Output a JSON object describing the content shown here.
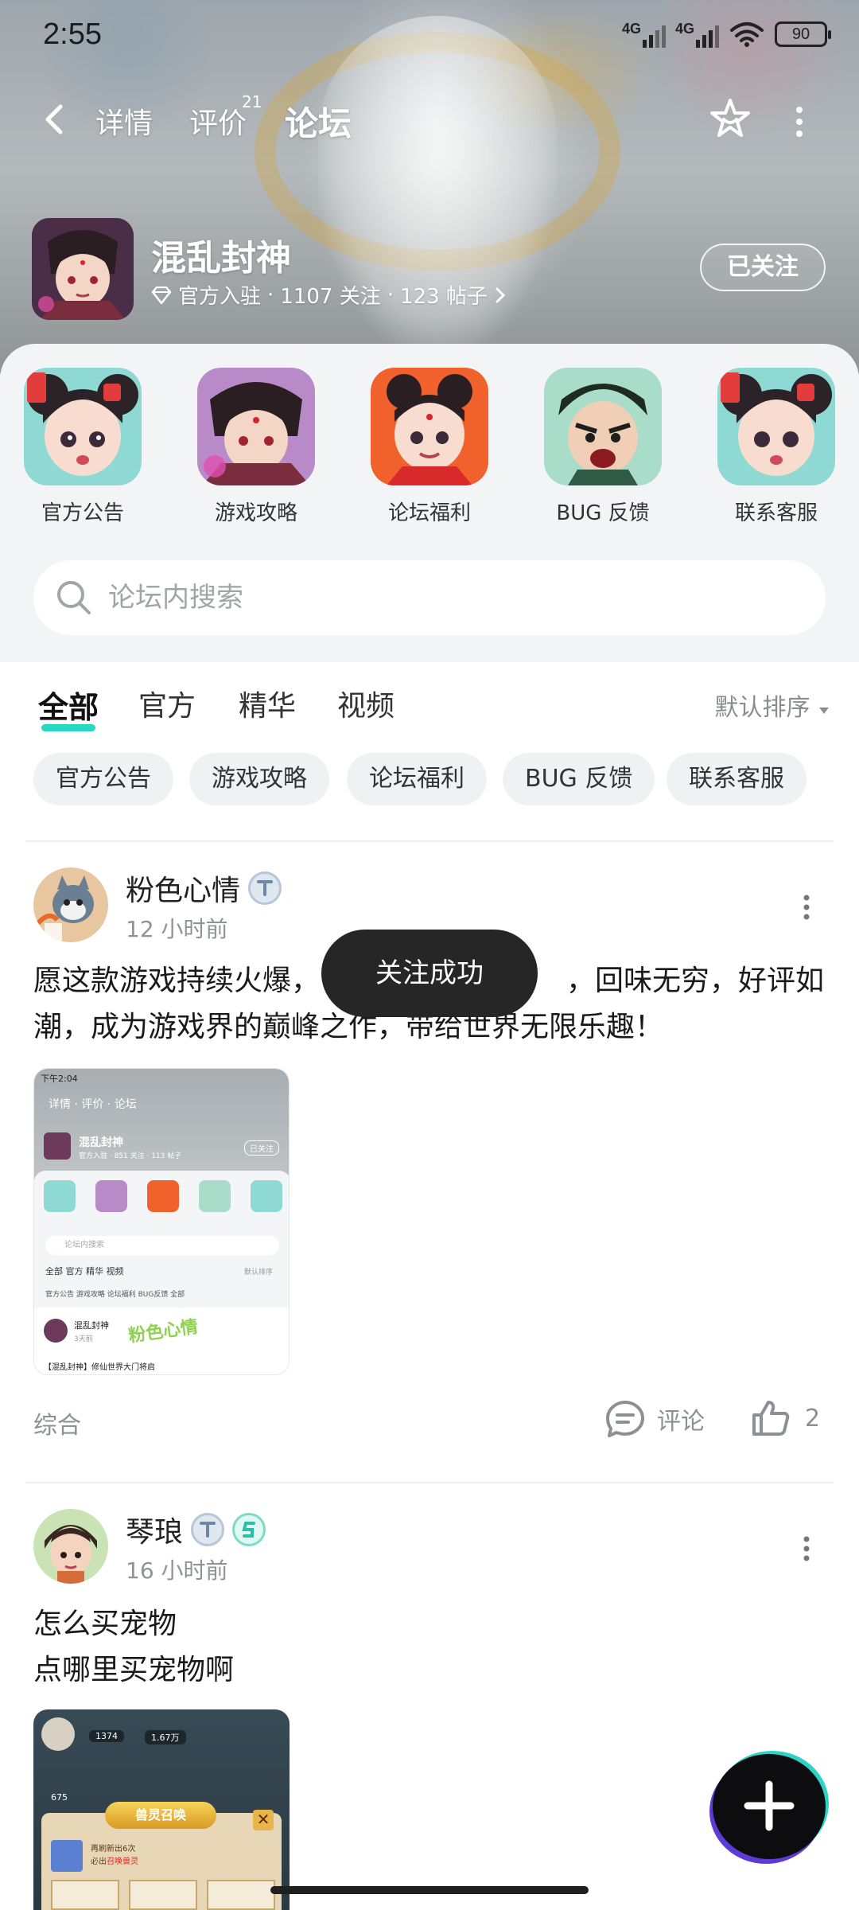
{
  "status_bar": {
    "time": "2:55",
    "network_1": "4G",
    "network_2": "4G",
    "battery": "90"
  },
  "nav": {
    "tabs": [
      {
        "label": "详情"
      },
      {
        "label": "评价",
        "count": "21"
      },
      {
        "label": "论坛"
      }
    ],
    "active_tab": "论坛"
  },
  "game": {
    "name": "混乱封神",
    "official": "官方入驻",
    "followers": "1107 关注",
    "posts": "123 帖子",
    "follow_button": "已关注"
  },
  "shortcuts": [
    {
      "label": "官方公告",
      "icon": "girl-character-icon"
    },
    {
      "label": "游戏攻略",
      "icon": "lord-character-icon"
    },
    {
      "label": "论坛福利",
      "icon": "boy-character-icon"
    },
    {
      "label": "BUG 反馈",
      "icon": "shouting-character-icon"
    },
    {
      "label": "联系客服",
      "icon": "girl-character-icon"
    }
  ],
  "search": {
    "placeholder": "论坛内搜索"
  },
  "filter_tabs": [
    "全部",
    "官方",
    "精华",
    "视频"
  ],
  "active_filter": "全部",
  "sort_label": "默认排序",
  "chips": [
    "官方公告",
    "游戏攻略",
    "论坛福利",
    "BUG 反馈",
    "联系客服"
  ],
  "posts": [
    {
      "author": "粉色心情",
      "time": "12 小时前",
      "text_line1": "愿这款游戏持续火爆，",
      "text_line1_tail": "，回味无穷，好评如",
      "text_line2": "潮，成为游戏界的巅峰之作，带给世界无限乐趣！",
      "category": "综合",
      "comment_label": "评论",
      "likes": "2",
      "thumb": {
        "time": "下午2:04",
        "nav": "详情 · 评价 · 论坛",
        "game": "混乱封神",
        "meta": "官方入驻 · 851 关注 · 113 帖子",
        "followed": "已关注",
        "search": "论坛内搜索",
        "tabs": "全部  官方  精华  视频",
        "sort": "默认排序",
        "chips": "官方公告  游戏攻略  论坛福利  BUG反馈  全部",
        "post_author": "混乱封神",
        "post_time": "3天前",
        "watermark": "粉色心情",
        "post_title": "【混乱封神】修仙世界大门将启"
      }
    },
    {
      "author": "琴琅",
      "time": "16 小时前",
      "text_line1": "怎么买宠物",
      "text_line2": "点哪里买宠物啊",
      "thumb": {
        "banner": "兽灵召唤",
        "level": "675",
        "stat1": "1374",
        "stat2": "1.67万",
        "desc": "再刷新出6次",
        "desc2": "必出",
        "highlight": "召唤兽灵"
      }
    }
  ],
  "toast": "关注成功"
}
